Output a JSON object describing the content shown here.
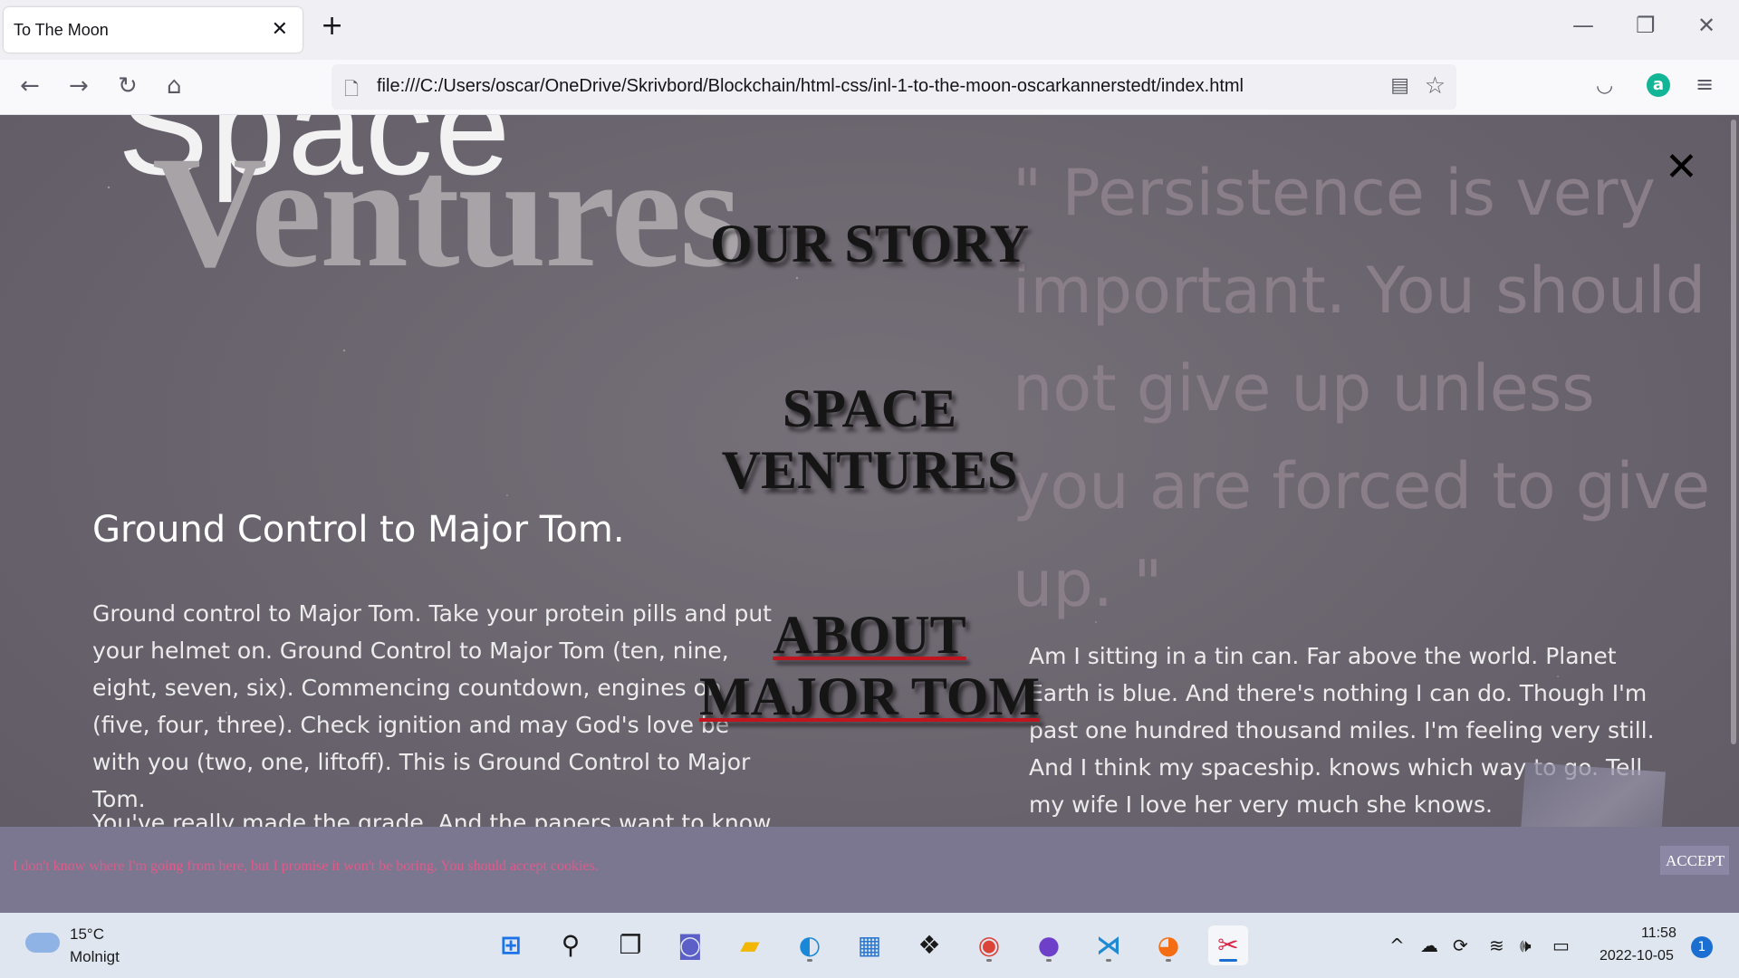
{
  "browser": {
    "tab_title": "To The Moon",
    "tab_close_icon": "close-icon",
    "new_tab_label": "+",
    "url": "file:///C:/Users/oscar/OneDrive/Skrivbord/Blockchain/html-css/inl-1-to-the-moon-oscarkannerstedt/index.html"
  },
  "page": {
    "logo_top": "Space",
    "logo_bottom": "Ventures",
    "quote": "\" Persistence is very important. You should not give up unless you are forced to give up. \"",
    "heading": "Ground Control to Major Tom.",
    "para_left_1": "Ground control to Major Tom. Take your protein pills and put your helmet on. Ground Control to Major Tom (ten, nine, eight, seven, six). Commencing countdown, engines on (five, four, three). Check ignition and may God's love be with you (two, one, liftoff). This is Ground Control to Major Tom.",
    "para_left_2": "You've really made the grade. And the papers want to know whose shirts you wear. Now it's time to leave the capsule if you dare.",
    "para_right": "Am I sitting in a tin can. Far above the world. Planet Earth is blue. And there's nothing I can do. Though I'm past one hundred thousand miles. I'm feeling very still. And I think my spaceship. knows which way to go. Tell my wife I love her very much she knows."
  },
  "menu": {
    "our_story": "OUR STORY",
    "space_ventures": "SPACE VENTURES",
    "about": "ABOUT MAJOR TOM",
    "active_underline_color": "#c0141e"
  },
  "cookie": {
    "text": "I don't know where I'm going from here, but I promise it won't be boring. You should accept cookies.",
    "accept_label": "ACCEPT"
  },
  "taskbar": {
    "temperature": "15°C",
    "weather": "Molnigt",
    "time": "11:58",
    "date": "2022-10-05",
    "notifications": "1"
  }
}
